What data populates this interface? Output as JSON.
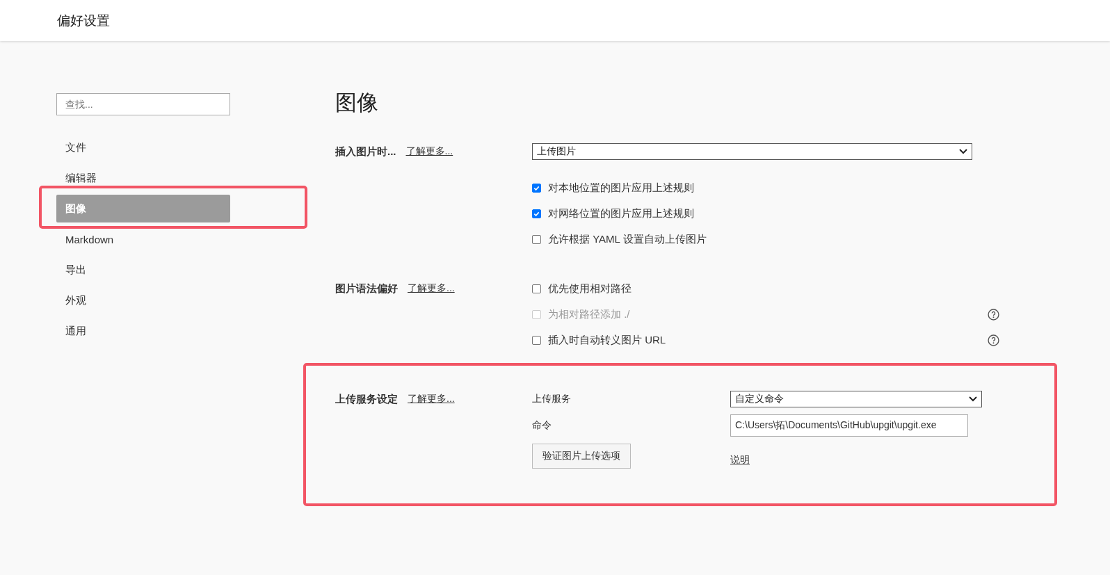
{
  "header": {
    "title": "偏好设置"
  },
  "sidebar": {
    "search": {
      "placeholder": "查找..."
    },
    "items": [
      {
        "label": "文件",
        "selected": false,
        "highlighted": false
      },
      {
        "label": "编辑器",
        "selected": false,
        "highlighted": false
      },
      {
        "label": "图像",
        "selected": true,
        "highlighted": true
      },
      {
        "label": "Markdown",
        "selected": false,
        "highlighted": false
      },
      {
        "label": "导出",
        "selected": false,
        "highlighted": false
      },
      {
        "label": "外观",
        "selected": false,
        "highlighted": false
      },
      {
        "label": "通用",
        "selected": false,
        "highlighted": false
      }
    ]
  },
  "page_title": "图像",
  "sections": [
    {
      "label": "插入图片时...",
      "link": "了解更多...",
      "highlighted": false,
      "rows": [
        {
          "kind": "select",
          "value": "上传图片"
        },
        {
          "kind": "checkbox",
          "label": "对本地位置的图片应用上述规则",
          "checked": true,
          "disabled": false,
          "help": false
        },
        {
          "kind": "checkbox",
          "label": "对网络位置的图片应用上述规则",
          "checked": true,
          "disabled": false,
          "help": false
        },
        {
          "kind": "checkbox",
          "label": "允许根据 YAML 设置自动上传图片",
          "checked": false,
          "disabled": false,
          "help": false
        }
      ]
    },
    {
      "label": "图片语法偏好",
      "link": "了解更多...",
      "highlighted": false,
      "rows": [
        {
          "kind": "checkbox",
          "label": "优先使用相对路径",
          "checked": false,
          "disabled": false,
          "help": false
        },
        {
          "kind": "checkbox",
          "label": "为相对路径添加 ./",
          "checked": false,
          "disabled": true,
          "help": true
        },
        {
          "kind": "checkbox",
          "label": "插入时自动转义图片 URL",
          "checked": false,
          "disabled": false,
          "help": true
        }
      ]
    },
    {
      "label": "上传服务设定",
      "link": "了解更多...",
      "highlighted": true,
      "rows": [
        {
          "kind": "labeled_select",
          "label": "上传服务",
          "value": "自定义命令"
        },
        {
          "kind": "labeled_input",
          "label": "命令",
          "value": "C:\\Users\\拓\\Documents\\GitHub\\upgit\\upgit.exe"
        },
        {
          "kind": "button_link",
          "button": "验证图片上传选项",
          "link": "说明"
        }
      ]
    }
  ]
}
